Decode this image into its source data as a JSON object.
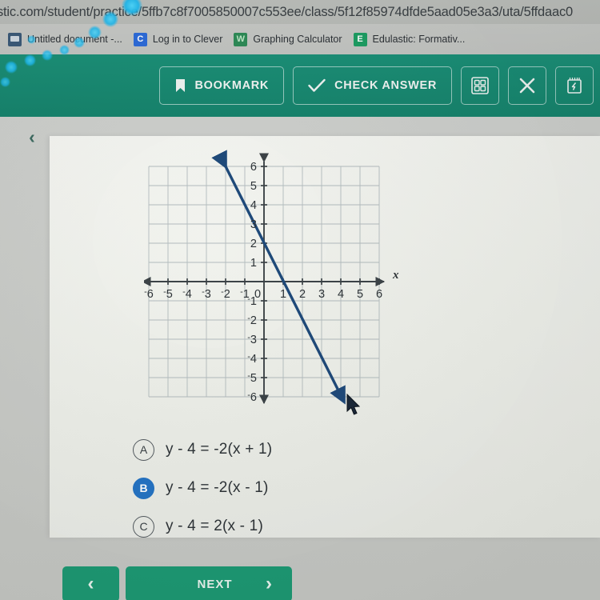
{
  "browser": {
    "url": "stic.com/student/practice/5ffb7c8f7005850007c553ee/class/5f12f85974dfde5aad05e3a3/uta/5ffdaac0",
    "bookmarks": [
      {
        "label": "Untitled document -...",
        "icon": "document-icon"
      },
      {
        "label": "Log in to Clever",
        "icon": "clever-c-icon"
      },
      {
        "label": "Graphing Calculator",
        "icon": "desmos-icon"
      },
      {
        "label": "Edulastic: Formativ...",
        "icon": "edulastic-e-icon"
      }
    ]
  },
  "header": {
    "bookmark_label": "BOOKMARK",
    "check_answer_label": "CHECK ANSWER",
    "calculator_icon": "grid-calculator-icon",
    "close_icon": "close-x-icon",
    "scratchpad_icon": "notepad-icon",
    "background_color": "#16836c"
  },
  "content": {
    "back_chevron": "‹"
  },
  "chart_data": {
    "type": "line",
    "title": "",
    "xlabel": "x",
    "ylabel": "",
    "xlim": [
      -6,
      6
    ],
    "ylim": [
      -6,
      6
    ],
    "grid": true,
    "x_ticks": [
      "-6",
      "-5",
      "-4",
      "-3",
      "-2",
      "-1",
      "0",
      "1",
      "2",
      "3",
      "4",
      "5",
      "6"
    ],
    "y_ticks": [
      "6",
      "5",
      "4",
      "3",
      "2",
      "1",
      "0",
      "-1",
      "-2",
      "-3",
      "-4",
      "-5",
      "-6"
    ],
    "series": [
      {
        "name": "line",
        "equation": "y = -2x + 2",
        "slope": -2,
        "y_intercept": 2,
        "x_intercept": 1,
        "points": [
          [
            -2,
            6
          ],
          [
            0,
            2
          ],
          [
            1,
            0
          ],
          [
            4,
            -6
          ]
        ],
        "arrows_both_ends": true,
        "color": "#1f4a7a"
      }
    ],
    "legend": "none"
  },
  "answers": {
    "options": [
      {
        "letter": "A",
        "text": "y - 4 = -2(x + 1)",
        "selected": false
      },
      {
        "letter": "B",
        "text": "y - 4 = -2(x - 1)",
        "selected": true
      },
      {
        "letter": "C",
        "text": "y - 4 = 2(x - 1)",
        "selected": false
      }
    ],
    "selected_color": "#2574c4"
  },
  "footer": {
    "prev_label": "‹",
    "next_label": "NEXT",
    "next_chevron": "›",
    "button_color": "#1d9a74"
  }
}
